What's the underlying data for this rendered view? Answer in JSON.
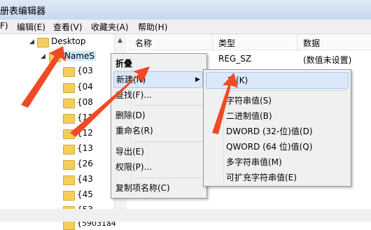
{
  "window": {
    "title": "册表编辑器"
  },
  "menubar": [
    "F)",
    "编辑(E)",
    "查看(V)",
    "收藏夹(A)",
    "帮助(H)"
  ],
  "tree": {
    "items": [
      {
        "label": "Desktop"
      },
      {
        "label": "NameS"
      },
      {
        "label": "{03"
      },
      {
        "label": "{04"
      },
      {
        "label": "{08"
      },
      {
        "label": "{11"
      },
      {
        "label": "{12"
      },
      {
        "label": "{13"
      },
      {
        "label": "{26"
      },
      {
        "label": "{43"
      },
      {
        "label": "{45"
      },
      {
        "label": "{53"
      },
      {
        "label": "{59031a4"
      }
    ]
  },
  "list": {
    "columns": [
      "名称",
      "类型",
      "数据"
    ],
    "rows": [
      {
        "type": "REG_SZ",
        "data": "(数值未设置)"
      }
    ]
  },
  "context_menu": {
    "items": [
      "折叠",
      "新建(N)",
      "查找(F)...",
      "删除(D)",
      "重命名(R)",
      "导出(E)",
      "权限(P)...",
      "复制项名称(C)"
    ]
  },
  "submenu": {
    "items": [
      "项(K)",
      "字符串值(S)",
      "二进制值(B)",
      "DWORD (32-位)值(D)",
      "QWORD (64 位)值(Q)",
      "多字符串值(M)",
      "可扩充字符串值(E)"
    ]
  },
  "colors": {
    "arrow": "#f04a23",
    "highlight": "#dbe8fa",
    "folder": "#f5cd5c"
  }
}
